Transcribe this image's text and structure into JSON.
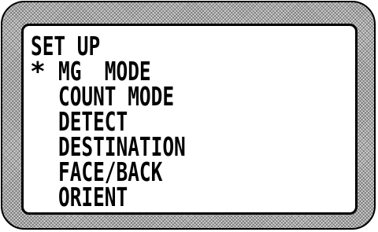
{
  "screen": {
    "title": "SET UP",
    "cursor": "*",
    "items": [
      {
        "label": "MG  MODE"
      },
      {
        "label": "COUNT MODE"
      },
      {
        "label": "DETECT"
      },
      {
        "label": "DESTINATION"
      },
      {
        "label": "FACE/BACK"
      },
      {
        "label": "ORIENT"
      }
    ]
  }
}
